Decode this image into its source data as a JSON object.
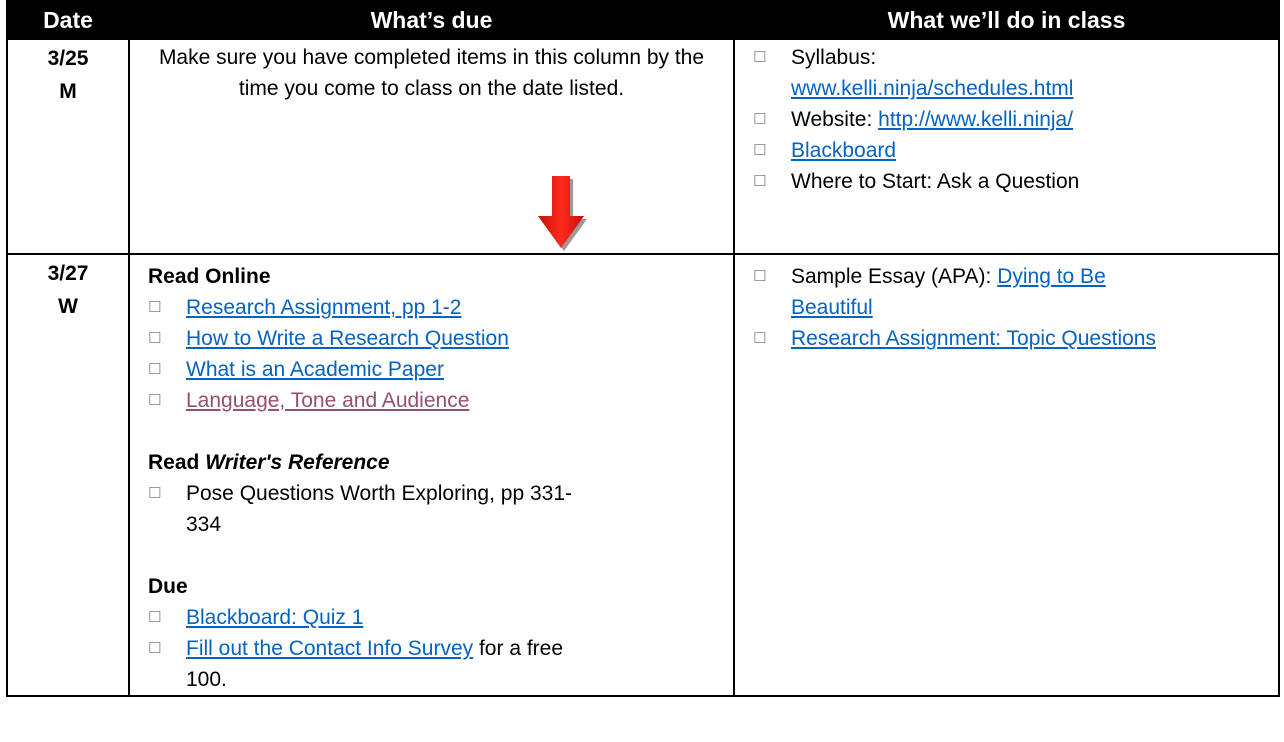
{
  "headers": {
    "date": "Date",
    "due": "What’s due",
    "inclass": "What we’ll do in class"
  },
  "rows": [
    {
      "date_line1": "3/25",
      "date_line2": "M",
      "due_intro": "Make sure you have completed items in this column by the time you come to class on the date listed.",
      "inclass": [
        {
          "text": "Syllabus:",
          "link": "www.kelli.ninja/schedules.html"
        },
        {
          "text": "Website: ",
          "link": "http://www.kelli.ninja/"
        },
        {
          "text": "",
          "link": "Blackboard"
        },
        {
          "text": "Where to Start: Ask a Question",
          "link": ""
        }
      ]
    },
    {
      "date_line1": "3/27",
      "date_line2": "W",
      "read_online_heading": "Read Online",
      "read_online": [
        "Research Assignment, pp 1-2",
        "How to Write a Research Question",
        "What is an Academic Paper",
        "Language, Tone and Audience"
      ],
      "read_ref_heading_prefix": "Read ",
      "read_ref_heading_italic": "Writer's Reference",
      "read_ref_item_line1": "Pose Questions Worth Exploring, pp 331-",
      "read_ref_item_line2": "334",
      "due_heading": "Due",
      "due_items": [
        {
          "link": "Blackboard: Quiz 1",
          "suffix": ""
        },
        {
          "link": "Fill out the Contact Info Survey",
          "suffix": " for a free"
        }
      ],
      "due_tail": "100.",
      "inclass": [
        {
          "text": "Sample Essay (APA): ",
          "link": "Dying to Be",
          "link_line2": "Beautiful"
        },
        {
          "text": "",
          "link": "Research Assignment: Topic Questions"
        }
      ]
    }
  ],
  "colors": {
    "header_bg": "#000000",
    "link": "#0563c1",
    "visited_link": "#954f72",
    "arrow": "#e8120c",
    "checkbox": "#7f7f7f"
  },
  "icons": {
    "checkbox": "☐",
    "arrow": "down-arrow-icon"
  }
}
